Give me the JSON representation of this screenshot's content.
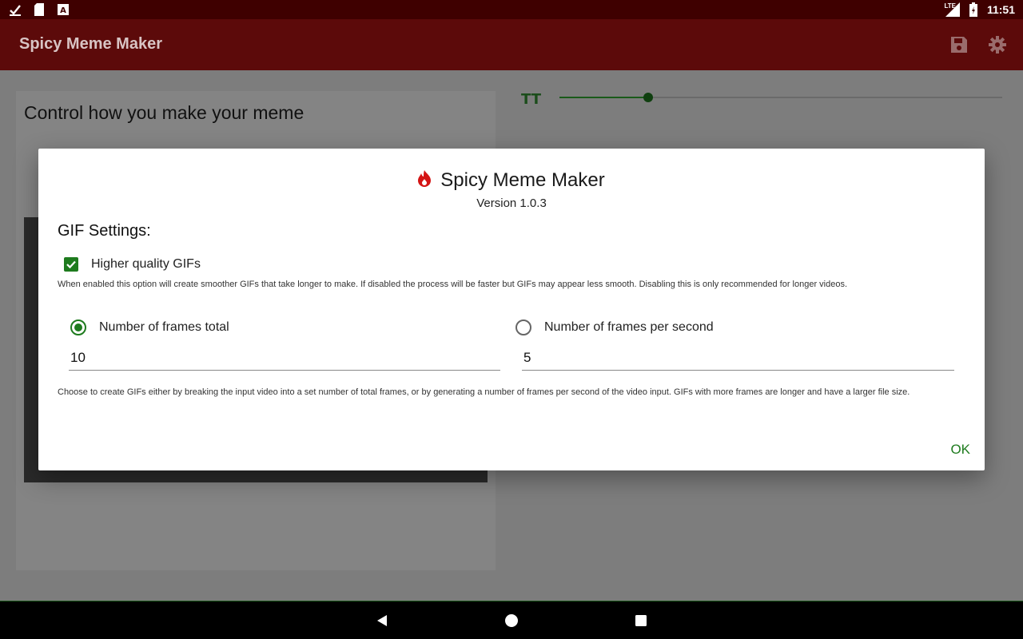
{
  "status_bar": {
    "time": "11:51",
    "network": "LTE",
    "icons": [
      "check-icon",
      "sd-card-icon",
      "keyboard-icon",
      "signal-icon",
      "battery-icon"
    ]
  },
  "app_bar": {
    "title": "Spicy Meme Maker",
    "actions": [
      "save-icon",
      "settings-icon"
    ]
  },
  "background": {
    "card_title": "Control how you make your meme",
    "text_size_icon": "TT",
    "slider_value_fraction": 0.2
  },
  "dialog": {
    "app_name": "Spicy Meme Maker",
    "version": "Version 1.0.3",
    "section_title": "GIF Settings:",
    "quality": {
      "label": "Higher quality GIFs",
      "checked": true,
      "description": "When enabled this option will create smoother GIFs that take longer to make. If disabled the process will be faster but GIFs may appear less smooth. Disabling this is only recommended for longer videos."
    },
    "frames_total": {
      "label": "Number of frames total",
      "selected": true,
      "value": "10"
    },
    "frames_per_second": {
      "label": "Number of frames per second",
      "selected": false,
      "value": "5"
    },
    "frames_description": "Choose to create GIFs either by breaking the input video into a set number of total frames, or by generating a number of frames per second of the video input. GIFs with more frames are longer and have a larger file size.",
    "ok_label": "OK"
  },
  "colors": {
    "status_bar": "#3f0000",
    "app_bar": "#5c0a0a",
    "accent": "#1e7b1e",
    "flame": "#d41414"
  }
}
